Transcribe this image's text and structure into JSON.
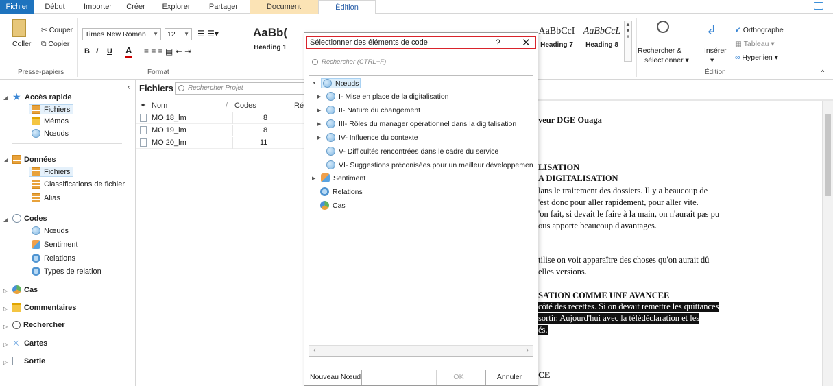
{
  "ribbon_tabs": [
    "Fichier",
    "Début",
    "Importer",
    "Créer",
    "Explorer",
    "Partager",
    "Document",
    "Édition"
  ],
  "clipboard": {
    "paste": "Coller",
    "cut": "Couper",
    "copy": "Copier",
    "group": "Presse-papiers"
  },
  "format": {
    "font": "Times New Roman",
    "size": "12",
    "bold": "B",
    "italic": "I",
    "underline": "U",
    "color_letter": "A",
    "group": "Format"
  },
  "styles": [
    {
      "preview": "AaBb(",
      "name": "Heading 1"
    },
    {
      "preview": "AaBbCcI",
      "name": "Heading 7"
    },
    {
      "preview": "AaBbCcL",
      "name": "Heading 8"
    }
  ],
  "edition": {
    "find_select": "Rechercher &",
    "find_select2": "sélectionner",
    "insert": "Insérer",
    "spelling": "Orthographe",
    "table": "Tableau",
    "hyperlink": "Hyperlien",
    "group": "Édition"
  },
  "nav": {
    "quick_access": "Accès rapide",
    "qa_items": [
      "Fichiers",
      "Mémos",
      "Nœuds"
    ],
    "data": "Données",
    "data_items": [
      "Fichiers",
      "Classifications de fichier",
      "Alias"
    ],
    "codes": "Codes",
    "codes_items": [
      "Nœuds",
      "Sentiment",
      "Relations",
      "Types de relation"
    ],
    "cases": "Cas",
    "comments": "Commentaires",
    "search": "Rechercher",
    "maps": "Cartes",
    "output": "Sortie"
  },
  "list": {
    "title": "Fichiers",
    "search_placeholder": "Rechercher Projet",
    "columns": [
      "Nom",
      "Codes",
      "Ré"
    ],
    "rows": [
      {
        "name": "MO 18_lm",
        "codes": "8"
      },
      {
        "name": "MO 19_lm",
        "codes": "8"
      },
      {
        "name": "MO 20_lm",
        "codes": "11"
      }
    ]
  },
  "document": {
    "lines": [
      "veur DGE Ouaga",
      "LISATION",
      "A DIGITALISATION",
      "lans le traitement des dossiers. Il y a beaucoup de",
      "'est donc pour aller rapidement, pour aller vite.",
      "'on fait, si devait le faire à la main, on n'aurait pas pu",
      "ous apporte beaucoup d'avantages.",
      "tilise on voit apparaître des choses qu'on aurait dû",
      "elles versions.",
      "SATION COMME UNE AVANCEE",
      "côté des recettes. Si on devait remettre les quittances",
      "sortir. Aujourd'hui avec la télédéclaration et les",
      "és.",
      "CE"
    ]
  },
  "dialog": {
    "title": "Sélectionner des éléments de code",
    "help": "?",
    "close": "✕",
    "search_placeholder": "Rechercher (CTRL+F)",
    "tree": {
      "root": "Nœuds",
      "children": [
        "I- Mise en place de la digitalisation",
        "II- Nature du changement",
        "III- Rôles du manager opérationnel dans la digitalisation",
        "IV- Influence du contexte",
        "V- Difficultés rencontrées dans le cadre du service",
        "VI- Suggestions préconisées pour un meilleur développement"
      ],
      "others": [
        "Sentiment",
        "Relations",
        "Cas"
      ]
    },
    "new_node": "Nouveau Nœud",
    "ok": "OK",
    "cancel": "Annuler"
  }
}
